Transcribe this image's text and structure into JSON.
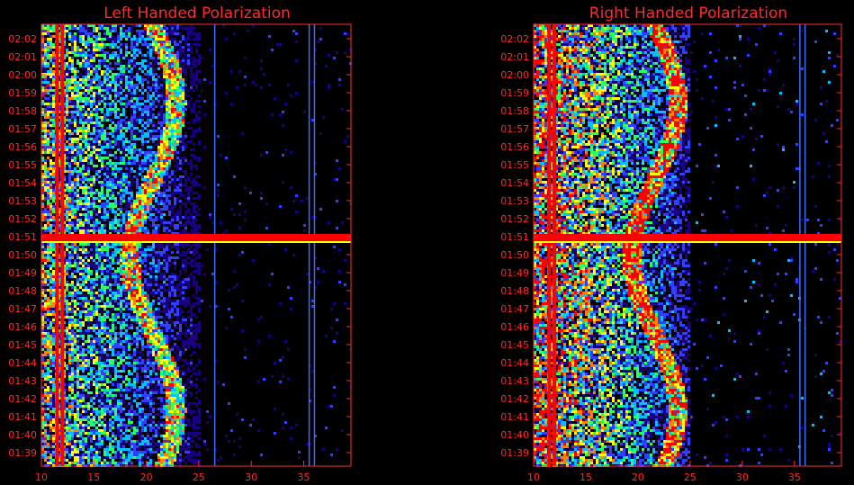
{
  "chart_data": [
    {
      "type": "heatmap",
      "title": "Left Handed Polarization",
      "xlabel": "",
      "ylabel": "",
      "xlim": [
        10,
        39.5
      ],
      "x_ticks": [
        "10",
        "15",
        "20",
        "25",
        "30",
        "35"
      ],
      "y_ticks": [
        "02:02",
        "02:01",
        "02:00",
        "01:59",
        "01:58",
        "01:57",
        "01:56",
        "01:55",
        "01:54",
        "01:53",
        "01:52",
        "01:51",
        "01:50",
        "01:49",
        "01:48",
        "01:47",
        "01:46",
        "01:45",
        "01:44",
        "01:43",
        "01:42",
        "01:41",
        "01:40",
        "01:39"
      ],
      "colormap": [
        "#000000",
        "#1a0080",
        "#3040ff",
        "#00c0ff",
        "#30ff60",
        "#ffff00",
        "#ff8000",
        "#ff0000"
      ],
      "features": {
        "saturated_band_time": "01:51",
        "vertical_lines_freq": [
          11.5,
          12.0,
          26.5,
          35.5,
          36.0
        ],
        "drifting_emission_freq_range": [
          17,
          24
        ]
      }
    },
    {
      "type": "heatmap",
      "title": "Right Handed Polarization",
      "xlabel": "",
      "ylabel": "",
      "xlim": [
        10,
        39.5
      ],
      "x_ticks": [
        "10",
        "15",
        "20",
        "25",
        "30",
        "35"
      ],
      "y_ticks": [
        "02:02",
        "02:01",
        "02:00",
        "01:59",
        "01:58",
        "01:57",
        "01:56",
        "01:55",
        "01:54",
        "01:53",
        "01:52",
        "01:51",
        "01:50",
        "01:49",
        "01:48",
        "01:47",
        "01:46",
        "01:45",
        "01:44",
        "01:43",
        "01:42",
        "01:41",
        "01:40",
        "01:39"
      ],
      "colormap": [
        "#000000",
        "#1a0080",
        "#3040ff",
        "#00c0ff",
        "#30ff60",
        "#ffff00",
        "#ff8000",
        "#ff0000"
      ],
      "features": {
        "saturated_band_time": "01:51",
        "vertical_lines_freq": [
          11.5,
          12.0,
          35.5,
          36.0
        ],
        "drifting_emission_freq_range": [
          15,
          24
        ]
      }
    }
  ]
}
